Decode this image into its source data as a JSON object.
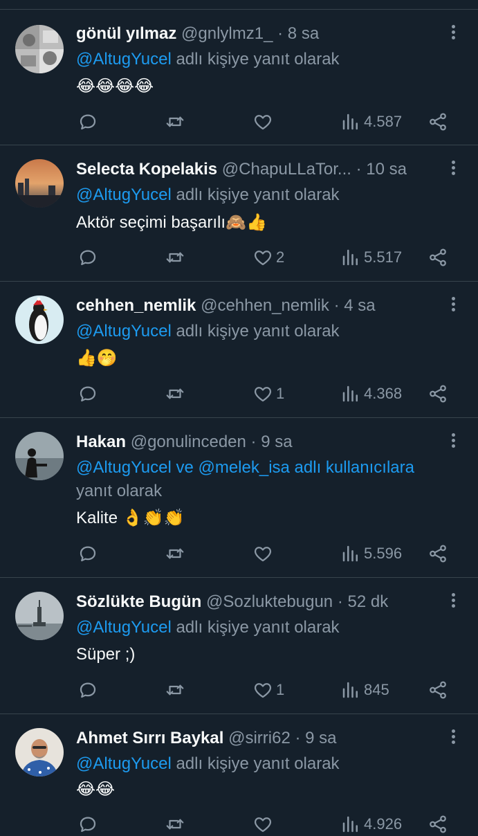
{
  "tweets": [
    {
      "name": "gönül yılmaz",
      "handle": "@gnlylmz1_",
      "time": "8 sa",
      "reply_mentions": "@AltugYucel",
      "reply_suffix": " adlı kişiye yanıt olarak",
      "reply_suffix2": "",
      "text": "😂😂😂😂",
      "likes": "",
      "views": "4.587",
      "avatar_icon": "gray-collage-avatar"
    },
    {
      "name": "Selecta Kopelakis",
      "handle": "@ChapuLLaTor...",
      "time": "10 sa",
      "reply_mentions": "@AltugYucel",
      "reply_suffix": " adlı kişiye yanıt olarak",
      "reply_suffix2": "",
      "text": "Aktör seçimi başarılı🙈👍",
      "likes": "2",
      "views": "5.517",
      "avatar_icon": "sunset-city-avatar"
    },
    {
      "name": "cehhen_nemlik",
      "handle": "@cehhen_nemlik",
      "time": "4 sa",
      "reply_mentions": "@AltugYucel",
      "reply_suffix": " adlı kişiye yanıt olarak",
      "reply_suffix2": "",
      "text": "👍🤭",
      "likes": "1",
      "views": "4.368",
      "avatar_icon": "penguin-avatar"
    },
    {
      "name": "Hakan",
      "handle": "@gonulinceden",
      "time": "9 sa",
      "reply_mentions": "@AltugYucel ve @melek_isa adlı kullanıcılara",
      "reply_suffix": "",
      "reply_suffix2": "yanıt olarak",
      "text": "Kalite 👌👏👏",
      "likes": "",
      "views": "5.596",
      "avatar_icon": "silhouette-sea-avatar"
    },
    {
      "name": "Sözlükte Bugün",
      "handle": "@Sozluktebugun",
      "time": "52 dk",
      "reply_mentions": "@AltugYucel",
      "reply_suffix": " adlı kişiye yanıt olarak",
      "reply_suffix2": "",
      "text": "Süper ;)",
      "likes": "1",
      "views": "845",
      "avatar_icon": "statue-of-liberty-avatar"
    },
    {
      "name": "Ahmet Sırrı Baykal",
      "handle": "@sirri62",
      "time": "9 sa",
      "reply_mentions": "@AltugYucel",
      "reply_suffix": " adlı kişiye yanıt olarak",
      "reply_suffix2": "",
      "text": "😂😂",
      "likes": "",
      "views": "4.926",
      "avatar_icon": "man-portrait-avatar"
    }
  ],
  "dot": "·",
  "colors": {
    "background": "#15202b",
    "divider": "#38444d",
    "secondary_text": "#8b98a5",
    "link": "#1d9bf0"
  }
}
